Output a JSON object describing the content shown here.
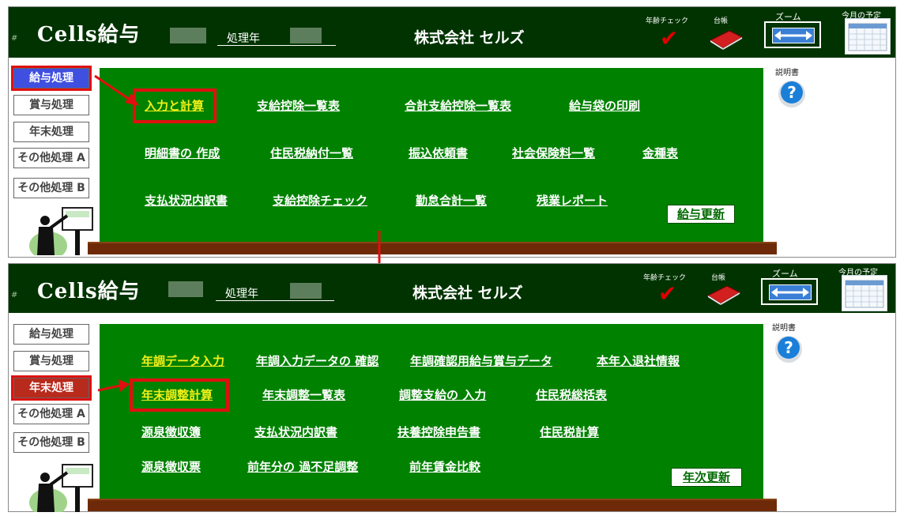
{
  "header": {
    "hash": "#",
    "app_title": "Cells給与",
    "year_label": "処理年",
    "company": "株式会社 セルズ",
    "age_check_label": "年齢チェック",
    "ledger_label": "台帳",
    "zoom_label": "ズーム",
    "schedule_label": "今月の予定"
  },
  "help": {
    "label": "説明書"
  },
  "panels": [
    {
      "sidebar": [
        "給与処理",
        "賞与処理",
        "年末処理",
        "その他処理 A",
        "その他処理 B"
      ],
      "active_index": 0,
      "menu": [
        [
          "入力と計算",
          "支給控除一覧表",
          "合計支給控除一覧表",
          "給与袋の印刷"
        ],
        [
          "明細書の 作成",
          "住民税納付一覧",
          "振込依頼書",
          "社会保険料一覧",
          "金種表"
        ],
        [
          "支払状況内訳書",
          "支給控除チェック",
          "勤怠合計一覧",
          "残業レポート"
        ]
      ],
      "update_button": "給与更新"
    },
    {
      "sidebar": [
        "給与処理",
        "賞与処理",
        "年末処理",
        "その他処理 A",
        "その他処理 B"
      ],
      "active_index": 2,
      "menu": [
        [
          "年調データ入力",
          "年調入力データの 確認",
          "年調確認用給与賞与データ",
          "本年入退社情報"
        ],
        [
          "年末調整計算",
          "年末調整一覧表",
          "調整支給の 入力",
          "住民税総括表"
        ],
        [
          "源泉徴収簿",
          "支払状況内訳書",
          "扶養控除申告書",
          "住民税計算"
        ],
        [
          "源泉徴収票",
          "前年分の 過不足調整",
          "前年賃金比較"
        ]
      ],
      "update_button": "年次更新"
    }
  ],
  "colors": {
    "header_bg": "#003300",
    "board_green": "#008200",
    "highlight_red": "#e01010",
    "link_yellow": "#f3ef1a",
    "active_blue": "#3f4fe0"
  }
}
